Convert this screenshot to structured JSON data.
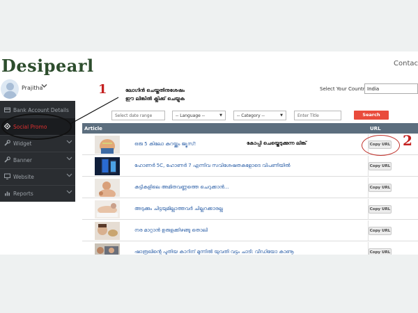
{
  "brand": {
    "logo": "Desipearl"
  },
  "header": {
    "contact": "Contact U"
  },
  "profile": {
    "name": "Prajitha"
  },
  "sidebar": {
    "items": [
      {
        "label": "Bank Account Details",
        "icon": "bank-icon",
        "active": false,
        "has_submenu": false
      },
      {
        "label": "Social Promo",
        "icon": "diamond-icon",
        "active": true,
        "has_submenu": false
      },
      {
        "label": "Widget",
        "icon": "wrench-icon",
        "active": false,
        "has_submenu": true
      },
      {
        "label": "Banner",
        "icon": "wrench-icon",
        "active": false,
        "has_submenu": true
      },
      {
        "label": "Website",
        "icon": "monitor-icon",
        "active": false,
        "has_submenu": true
      },
      {
        "label": "Reports",
        "icon": "chart-icon",
        "active": false,
        "has_submenu": true
      }
    ]
  },
  "annotations": {
    "marker_1": "1",
    "marker_2": "2",
    "note_1_line1": "ലോഗിൻ ചെയ്തതിനുശേഷം",
    "note_1_line2": "ഈ ലിങ്കിൽ ക്ലിക്ക് ചെയ്യുക",
    "note_2": "കോപ്പി ചെയ്തെടുക്കുന്ന ലിങ്ക്"
  },
  "country": {
    "label": "Select Your Country",
    "value": "India"
  },
  "filters": {
    "date_placeholder": "Select date range",
    "language": "-- Language --",
    "category": "-- Category --",
    "title_placeholder": "Enter Title",
    "search_label": "Search"
  },
  "table": {
    "headers": {
      "article": "Article",
      "url": "URL"
    },
    "copy_label": "Copy URL",
    "rows": [
      {
        "title": "ഒരു 5 കിലോ കുറയ്ക്കും ജ്യൂസ്!"
      },
      {
        "title": "ഹോണർ 5C, ഹോണർ 7 എന്നിവ സവിശേഷതകളോടെ വിപണിയിൽ"
      },
      {
        "title": "കുട്ടികളിലെ അമിതവണ്ണത്തെ ചെറുക്കാൻ..."
      },
      {
        "title": "അടുക്കും ചിട്ടയുമില്ലാത്തവർ ചില്ലറക്കാരല്ല"
      },
      {
        "title": "നര മാറ്റാൻ ഉരുളക്കിഴങ്ങു തൊലി"
      },
      {
        "title": "ഷാരൂഖിന്റെ പുതിയ കാറിന് മുന്നിൽ യുവതി വട്ടം ചാടി: വീഡിയോ കാണൂ"
      }
    ]
  }
}
